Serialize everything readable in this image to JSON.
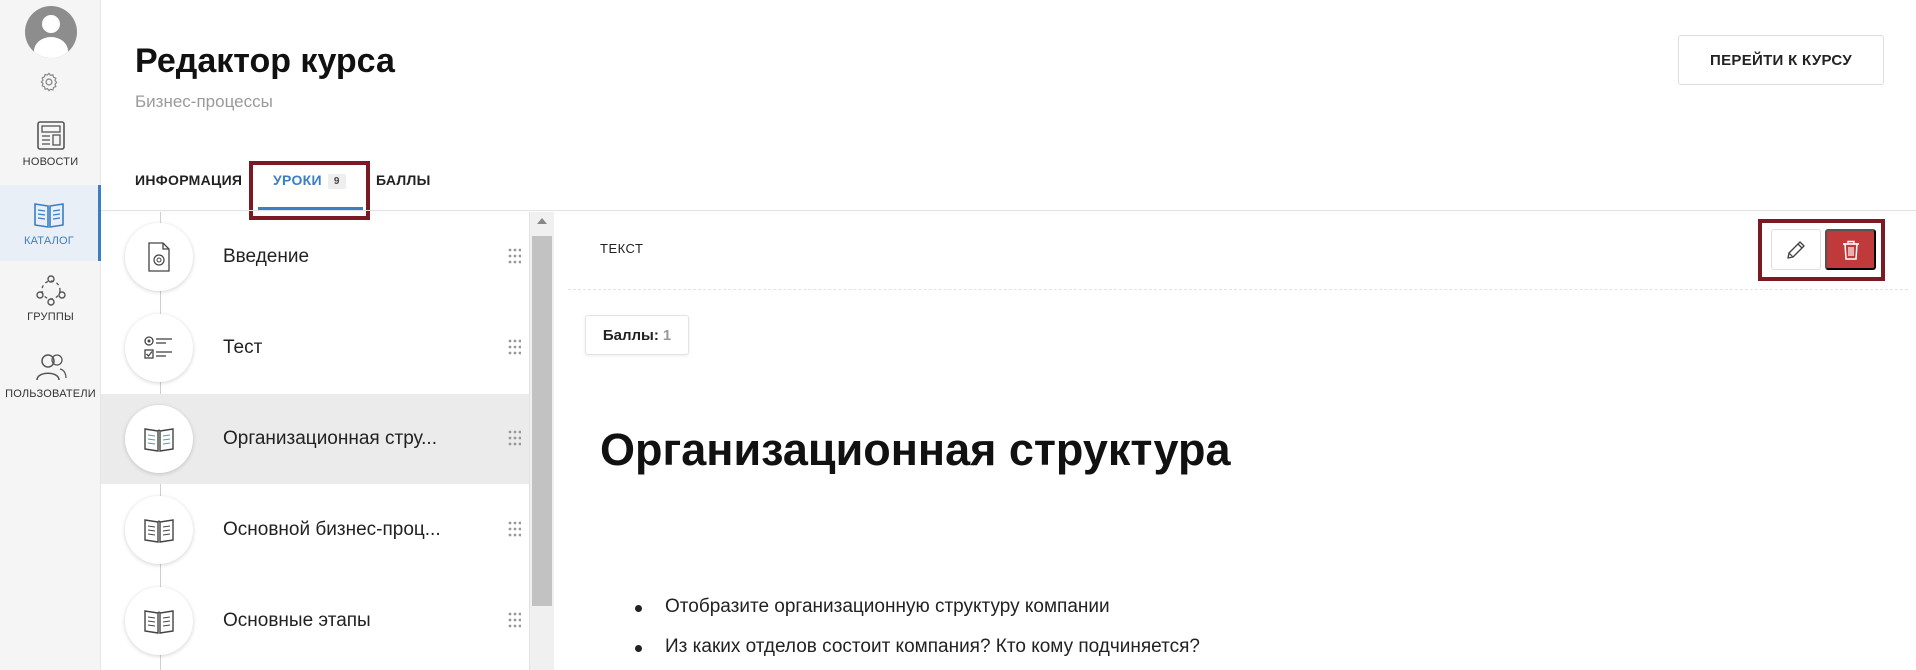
{
  "rail": {
    "items": [
      {
        "label": "НОВОСТИ",
        "icon": "newspaper-icon"
      },
      {
        "label": "КАТАЛОГ",
        "icon": "book-icon"
      },
      {
        "label": "ГРУППЫ",
        "icon": "groups-icon"
      },
      {
        "label": "ПОЛЬЗОВАТЕЛИ",
        "icon": "users-icon"
      }
    ],
    "active_index": 1,
    "accent": "#3c7ec2"
  },
  "header": {
    "title": "Редактор курса",
    "subtitle": "Бизнес-процессы",
    "go_to_course_label": "ПЕРЕЙТИ К КУРСУ"
  },
  "tabs": [
    {
      "label": "ИНФОРМАЦИЯ"
    },
    {
      "label": "УРОКИ",
      "count": "9",
      "active": true
    },
    {
      "label": "БАЛЛЫ"
    }
  ],
  "lessons": [
    {
      "name": "Введение",
      "icon": "document-icon"
    },
    {
      "name": "Тест",
      "icon": "quiz-checklist-icon"
    },
    {
      "name": "Организационная стру...",
      "icon": "open-book-icon",
      "selected": true
    },
    {
      "name": "Основной бизнес-проц...",
      "icon": "open-book-icon"
    },
    {
      "name": "Основные этапы",
      "icon": "open-book-icon"
    }
  ],
  "content": {
    "type_label": "ТЕКСТ",
    "points_label": "Баллы:",
    "points_value": "1",
    "heading": "Организационная структура",
    "bullets": [
      "Отобразите организационную структуру компании",
      "Из каких отделов состоит компания? Кто кому подчиняется?"
    ],
    "delete_color": "#c0393b",
    "highlight_color": "#7b1a24"
  }
}
